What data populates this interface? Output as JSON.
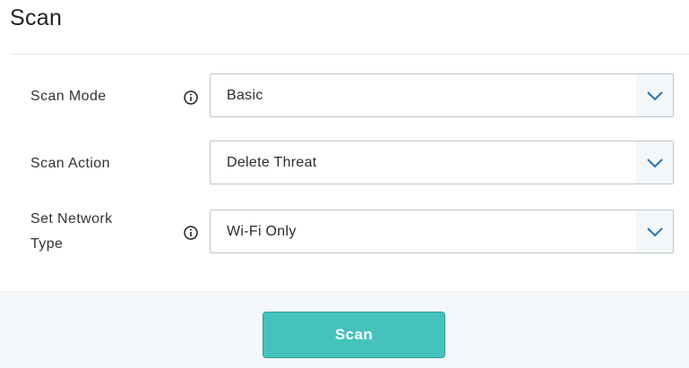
{
  "header": {
    "title": "Scan"
  },
  "form": {
    "scan_mode": {
      "label": "Scan Mode",
      "value": "Basic",
      "info_icon": "info-icon"
    },
    "scan_action": {
      "label": "Scan Action",
      "value": "Delete Threat"
    },
    "network_type": {
      "label_line1": "Set Network",
      "label_line2": "Type",
      "value": "Wi-Fi Only",
      "info_icon": "info-icon"
    }
  },
  "footer": {
    "scan_button_label": "Scan"
  },
  "colors": {
    "button_bg": "#46c2bd",
    "chevron": "#1f73b7",
    "footer_bg": "#f4f8fb"
  }
}
